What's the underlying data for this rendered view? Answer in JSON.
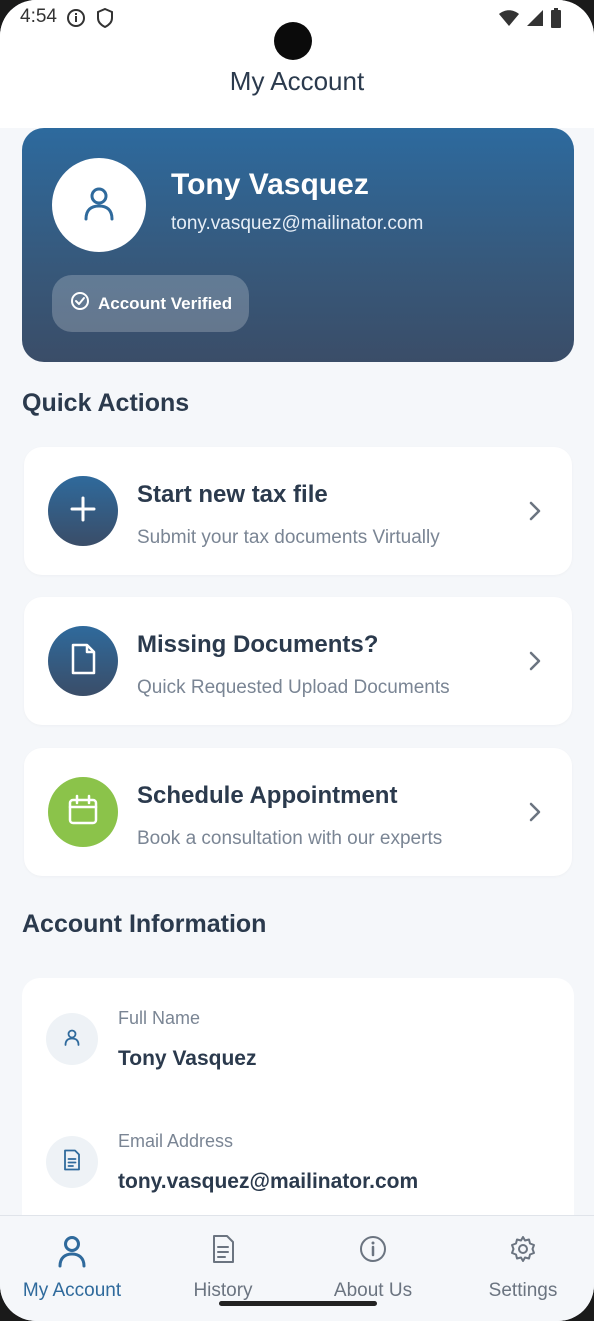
{
  "status_bar": {
    "time": "4:54"
  },
  "header": {
    "title": "My Account"
  },
  "profile": {
    "name": "Tony Vasquez",
    "email": "tony.vasquez@mailinator.com",
    "verified_label": "Account Verified"
  },
  "quick_actions": {
    "title": "Quick Actions",
    "items": [
      {
        "title": "Start new tax file",
        "subtitle": "Submit your tax documents Virtually",
        "icon": "plus-icon",
        "color": "#2f5f8a"
      },
      {
        "title": "Missing Documents?",
        "subtitle": "Quick Requested Upload Documents",
        "icon": "document-icon",
        "color": "#2f5f8a"
      },
      {
        "title": "Schedule Appointment",
        "subtitle": "Book a consultation with our experts",
        "icon": "calendar-icon",
        "color": "#8bc34a"
      }
    ]
  },
  "account_info": {
    "title": "Account Information",
    "fields": [
      {
        "label": "Full Name",
        "value": "Tony Vasquez",
        "icon": "user-icon"
      },
      {
        "label": "Email Address",
        "value": "tony.vasquez@mailinator.com",
        "icon": "document-icon"
      }
    ]
  },
  "bottom_nav": {
    "items": [
      {
        "label": "My Account",
        "icon": "user-icon",
        "active": true
      },
      {
        "label": "History",
        "icon": "document-icon",
        "active": false
      },
      {
        "label": "About Us",
        "icon": "info-icon",
        "active": false
      },
      {
        "label": "Settings",
        "icon": "gear-icon",
        "active": false
      }
    ]
  },
  "colors": {
    "accent": "#2f6a9c",
    "text_dark": "#2b3a4d",
    "text_muted": "#7a8594",
    "green": "#8bc34a"
  }
}
